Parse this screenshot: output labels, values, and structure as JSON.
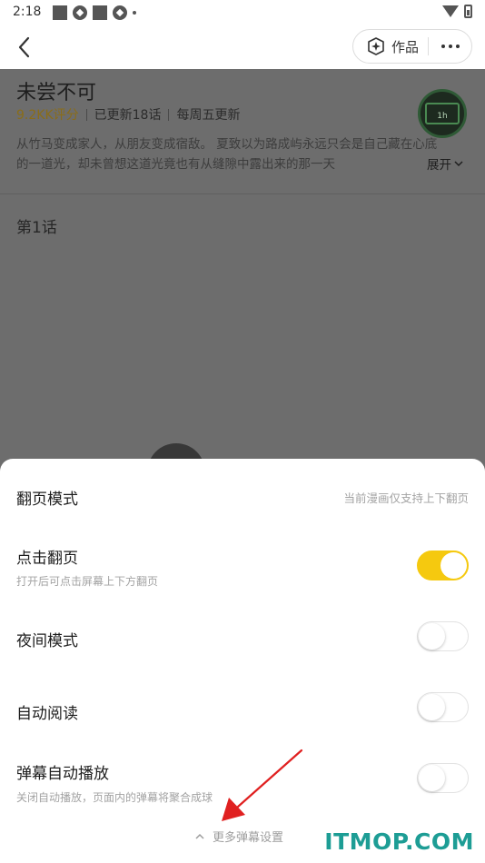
{
  "status_bar": {
    "time": "2:18"
  },
  "nav": {
    "works_label": "作品",
    "works_icon": "works-icon",
    "more_icon": "more-dots-icon"
  },
  "comic": {
    "title": "未尝不可",
    "score": "9.2KK评分",
    "updated": "已更新18话",
    "schedule": "每周五更新",
    "description": "从竹马变成家人，从朋友变成宿敌。 夏致以为路成屿永远只会是自己藏在心底的一道光，却未曾想这道光竟也有从缝隙中露出来的那一天",
    "expand_label": "展开",
    "badge_text": "1h",
    "episode": "第1话"
  },
  "settings": {
    "page_mode_title": "翻页模式",
    "page_mode_note": "当前漫画仅支持上下翻页",
    "tap_page_title": "点击翻页",
    "tap_page_sub": "打开后可点击屏幕上下方翻页",
    "tap_page_on": true,
    "night_mode_title": "夜间模式",
    "night_mode_on": false,
    "auto_read_title": "自动阅读",
    "auto_read_on": false,
    "danmu_title": "弹幕自动播放",
    "danmu_sub": "关闭自动播放，页面内的弹幕将聚合成球",
    "danmu_on": false,
    "more_danmu": "更多弹幕设置"
  },
  "watermark": "ITMOP.COM",
  "colors": {
    "accent": "#f5c90f",
    "watermark": "#1d9d95",
    "arrow": "#e02020"
  }
}
